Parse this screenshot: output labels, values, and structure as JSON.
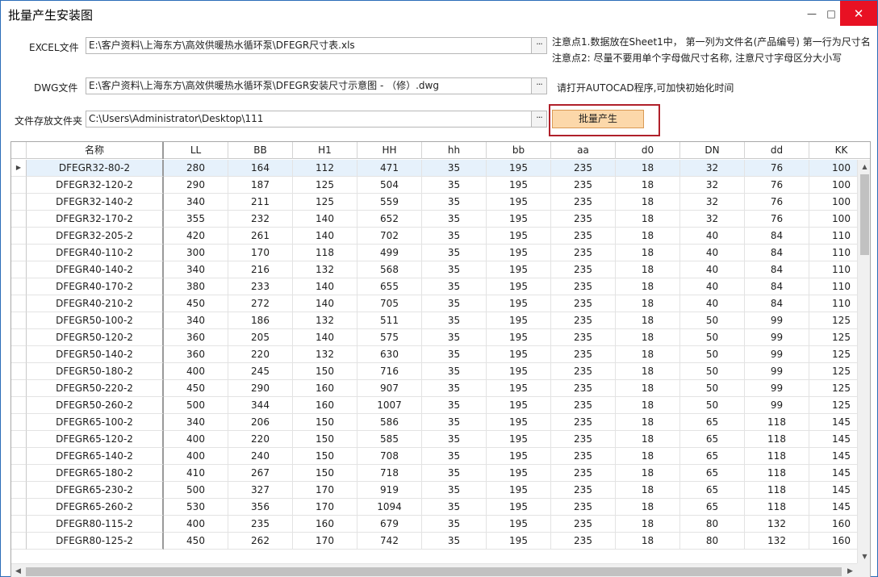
{
  "window": {
    "title": "批量产生安装图",
    "minimize_glyph": "—",
    "maximize_glyph": "□",
    "close_glyph": "✕"
  },
  "form": {
    "excel_label": "EXCEL文件",
    "excel_path": "E:\\客户资料\\上海东方\\高效供暖热水循环泵\\DFEGR尺寸表.xls",
    "dwg_label": "DWG文件",
    "dwg_path": "E:\\客户资料\\上海东方\\高效供暖热水循环泵\\DFEGR安装尺寸示意图 - （修）.dwg",
    "folder_label": "文件存放文件夹",
    "folder_path": "C:\\Users\\Administrator\\Desktop\\111",
    "browse_glyph": "···",
    "note1": "注意点1.数据放在Sheet1中， 第一列为文件名(产品编号) 第一行为尺寸名",
    "note2": "注意点2: 尽量不要用单个字母做尺寸名称, 注意尺寸字母区分大小写",
    "note3": "请打开AUTOCAD程序,可加快初始化时间",
    "generate_label": "批量产生"
  },
  "grid": {
    "columns": [
      "名称",
      "LL",
      "BB",
      "H1",
      "HH",
      "hh",
      "bb",
      "aa",
      "d0",
      "DN",
      "dd",
      "KK"
    ],
    "selected_row_index": 0,
    "row_indicator_glyph": "▶",
    "rows": [
      [
        "DFEGR32-80-2",
        "280",
        "164",
        "112",
        "471",
        "35",
        "195",
        "235",
        "18",
        "32",
        "76",
        "100"
      ],
      [
        "DFEGR32-120-2",
        "290",
        "187",
        "125",
        "504",
        "35",
        "195",
        "235",
        "18",
        "32",
        "76",
        "100"
      ],
      [
        "DFEGR32-140-2",
        "340",
        "211",
        "125",
        "559",
        "35",
        "195",
        "235",
        "18",
        "32",
        "76",
        "100"
      ],
      [
        "DFEGR32-170-2",
        "355",
        "232",
        "140",
        "652",
        "35",
        "195",
        "235",
        "18",
        "32",
        "76",
        "100"
      ],
      [
        "DFEGR32-205-2",
        "420",
        "261",
        "140",
        "702",
        "35",
        "195",
        "235",
        "18",
        "40",
        "84",
        "110"
      ],
      [
        "DFEGR40-110-2",
        "300",
        "170",
        "118",
        "499",
        "35",
        "195",
        "235",
        "18",
        "40",
        "84",
        "110"
      ],
      [
        "DFEGR40-140-2",
        "340",
        "216",
        "132",
        "568",
        "35",
        "195",
        "235",
        "18",
        "40",
        "84",
        "110"
      ],
      [
        "DFEGR40-170-2",
        "380",
        "233",
        "140",
        "655",
        "35",
        "195",
        "235",
        "18",
        "40",
        "84",
        "110"
      ],
      [
        "DFEGR40-210-2",
        "450",
        "272",
        "140",
        "705",
        "35",
        "195",
        "235",
        "18",
        "40",
        "84",
        "110"
      ],
      [
        "DFEGR50-100-2",
        "340",
        "186",
        "132",
        "511",
        "35",
        "195",
        "235",
        "18",
        "50",
        "99",
        "125"
      ],
      [
        "DFEGR50-120-2",
        "360",
        "205",
        "140",
        "575",
        "35",
        "195",
        "235",
        "18",
        "50",
        "99",
        "125"
      ],
      [
        "DFEGR50-140-2",
        "360",
        "220",
        "132",
        "630",
        "35",
        "195",
        "235",
        "18",
        "50",
        "99",
        "125"
      ],
      [
        "DFEGR50-180-2",
        "400",
        "245",
        "150",
        "716",
        "35",
        "195",
        "235",
        "18",
        "50",
        "99",
        "125"
      ],
      [
        "DFEGR50-220-2",
        "450",
        "290",
        "160",
        "907",
        "35",
        "195",
        "235",
        "18",
        "50",
        "99",
        "125"
      ],
      [
        "DFEGR50-260-2",
        "500",
        "344",
        "160",
        "1007",
        "35",
        "195",
        "235",
        "18",
        "50",
        "99",
        "125"
      ],
      [
        "DFEGR65-100-2",
        "340",
        "206",
        "150",
        "586",
        "35",
        "195",
        "235",
        "18",
        "65",
        "118",
        "145"
      ],
      [
        "DFEGR65-120-2",
        "400",
        "220",
        "150",
        "585",
        "35",
        "195",
        "235",
        "18",
        "65",
        "118",
        "145"
      ],
      [
        "DFEGR65-140-2",
        "400",
        "240",
        "150",
        "708",
        "35",
        "195",
        "235",
        "18",
        "65",
        "118",
        "145"
      ],
      [
        "DFEGR65-180-2",
        "410",
        "267",
        "150",
        "718",
        "35",
        "195",
        "235",
        "18",
        "65",
        "118",
        "145"
      ],
      [
        "DFEGR65-230-2",
        "500",
        "327",
        "170",
        "919",
        "35",
        "195",
        "235",
        "18",
        "65",
        "118",
        "145"
      ],
      [
        "DFEGR65-260-2",
        "530",
        "356",
        "170",
        "1094",
        "35",
        "195",
        "235",
        "18",
        "65",
        "118",
        "145"
      ],
      [
        "DFEGR80-115-2",
        "400",
        "235",
        "160",
        "679",
        "35",
        "195",
        "235",
        "18",
        "80",
        "132",
        "160"
      ],
      [
        "DFEGR80-125-2",
        "450",
        "262",
        "170",
        "742",
        "35",
        "195",
        "235",
        "18",
        "80",
        "132",
        "160"
      ]
    ],
    "scroll_up_glyph": "▲",
    "scroll_down_glyph": "▼",
    "scroll_left_glyph": "◀",
    "scroll_right_glyph": "▶"
  }
}
